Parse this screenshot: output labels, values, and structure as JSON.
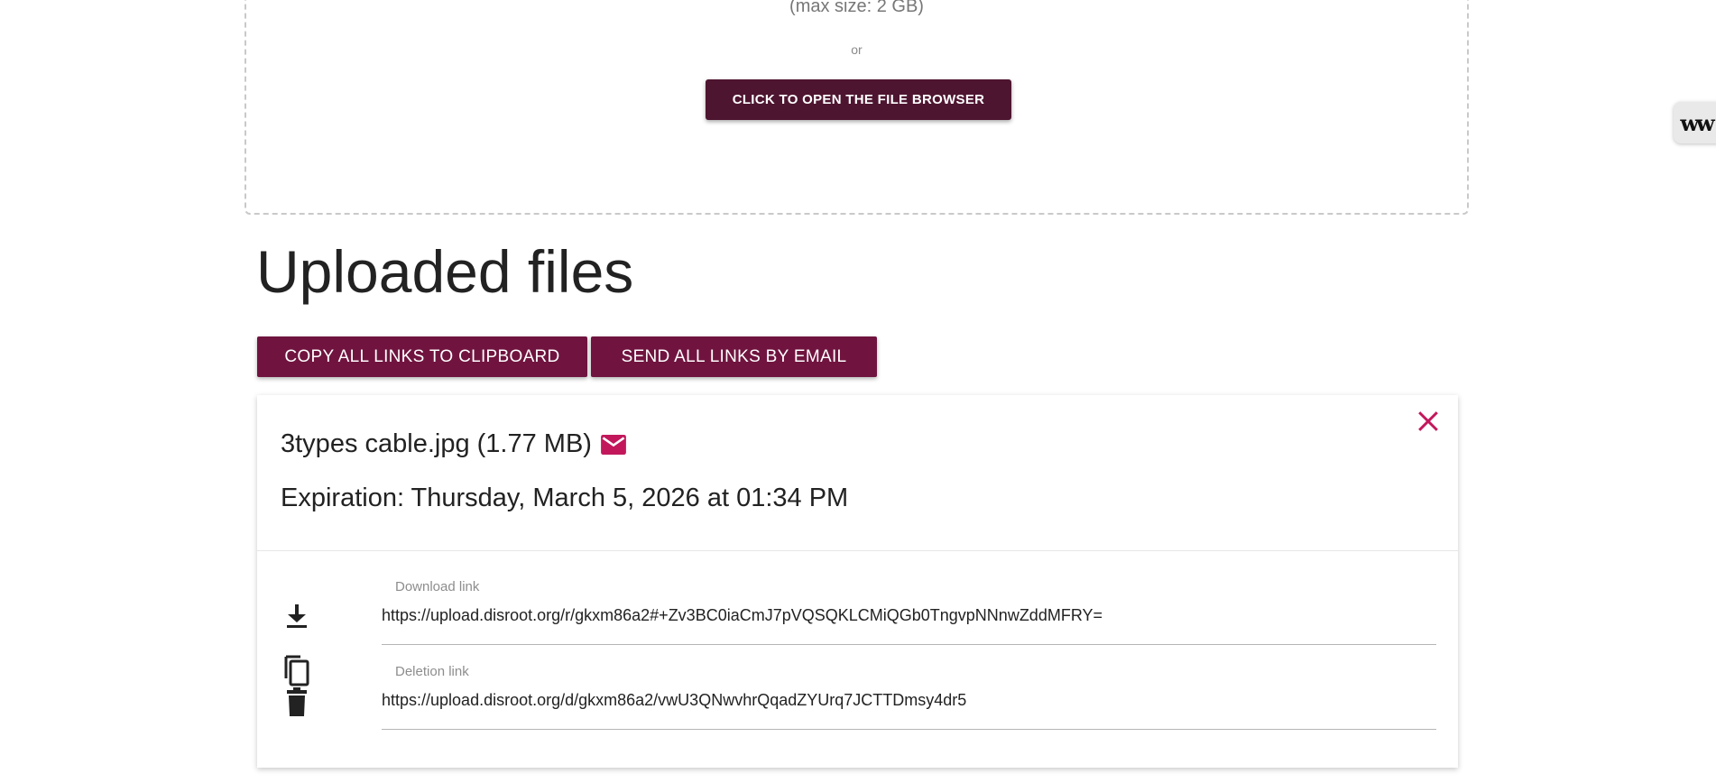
{
  "dropzone": {
    "max_size": "(max size: 2 GB)",
    "or": "or",
    "browse_button": "CLICK TO OPEN THE FILE BROWSER"
  },
  "side_widget": {
    "label": "w"
  },
  "uploaded": {
    "title": "Uploaded files",
    "copy_all_button": "COPY ALL LINKS TO CLIPBOARD",
    "email_all_button": "SEND ALL LINKS BY EMAIL"
  },
  "file": {
    "name_size": "3types cable.jpg (1.77 MB)",
    "expiration": "Expiration: Thursday, March 5, 2026 at 01:34 PM",
    "download_label": "Download link",
    "download_url": "https://upload.disroot.org/r/gkxm86a2#+Zv3BC0iaCmJ7pVQSQKLCMiQGb0TngvpNNnwZddMFRY=",
    "deletion_label": "Deletion link",
    "deletion_url": "https://upload.disroot.org/d/gkxm86a2/vwU3QNwvhrQqadZYUrq7JCTTDmsy4dr5"
  },
  "colors": {
    "dark_button": "#4e1530",
    "action_button": "#70143f",
    "accent_icon": "#c2185b"
  },
  "icons": [
    "mail-icon",
    "close-icon",
    "download-icon",
    "copy-icon",
    "trash-icon"
  ]
}
